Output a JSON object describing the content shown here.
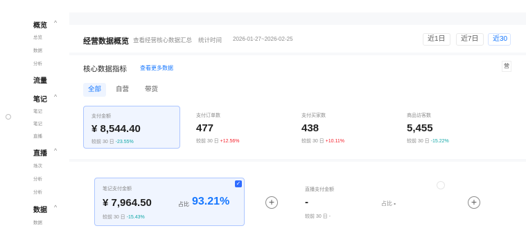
{
  "nav": {
    "groups": [
      {
        "label": "概览",
        "chevron": "^",
        "items": [
          "总览",
          "数据",
          "分析"
        ]
      },
      {
        "label": "流量",
        "chevron": "",
        "items": []
      },
      {
        "label": "笔记",
        "chevron": "^",
        "items": [
          "笔记",
          "笔记",
          "直播"
        ]
      },
      {
        "label": "直播",
        "chevron": "^",
        "items": [
          "场次",
          "分析",
          "分析"
        ]
      },
      {
        "label": "数据",
        "chevron": "^",
        "items": [
          "数据"
        ]
      }
    ]
  },
  "header": {
    "title": "经营数据概览",
    "subtitle": "查看经营核心数据汇总",
    "range_label": "统计时间",
    "range_value": "2026-01-27~2026-02-25",
    "quick_ranges": [
      "近1日",
      "近7日",
      "近30"
    ]
  },
  "core": {
    "title": "核心数据指标",
    "link": "查看更多数据",
    "right_button": "营"
  },
  "filters": [
    "全部",
    "自营",
    "带货"
  ],
  "metrics": [
    {
      "label": "支付金额",
      "value": "¥ 8,544.40",
      "comp_label": "较前 30 日",
      "comp_value": "-23.55%",
      "trend": "down",
      "selected": true
    },
    {
      "label": "支付订单数",
      "value": "477",
      "comp_label": "较前 30 日",
      "comp_value": "+12.56%",
      "trend": "up",
      "selected": false
    },
    {
      "label": "支付买家数",
      "value": "438",
      "comp_label": "较前 30 日",
      "comp_value": "+10.11%",
      "trend": "up",
      "selected": false
    },
    {
      "label": "商品访客数",
      "value": "5,455",
      "comp_label": "较前 30 日",
      "comp_value": "-15.22%",
      "trend": "down",
      "selected": false
    }
  ],
  "breakdown": [
    {
      "label": "笔记支付金额",
      "value": "¥ 7,964.50",
      "pct_label": "占比",
      "pct_value": "93.21%",
      "comp_label": "较前 30 日",
      "comp_value": "-15.43%"
    },
    {
      "label": "直播支付金额",
      "value": "-",
      "pct_label": "占比",
      "pct_value": "-",
      "comp_label": "较前 30 日",
      "comp_value": "-"
    }
  ],
  "icons": {
    "check": "✓",
    "plus": "+",
    "info": "?"
  },
  "colors": {
    "accent": "#1677ff",
    "up": "#f5222d",
    "down": "#13a8a8"
  }
}
